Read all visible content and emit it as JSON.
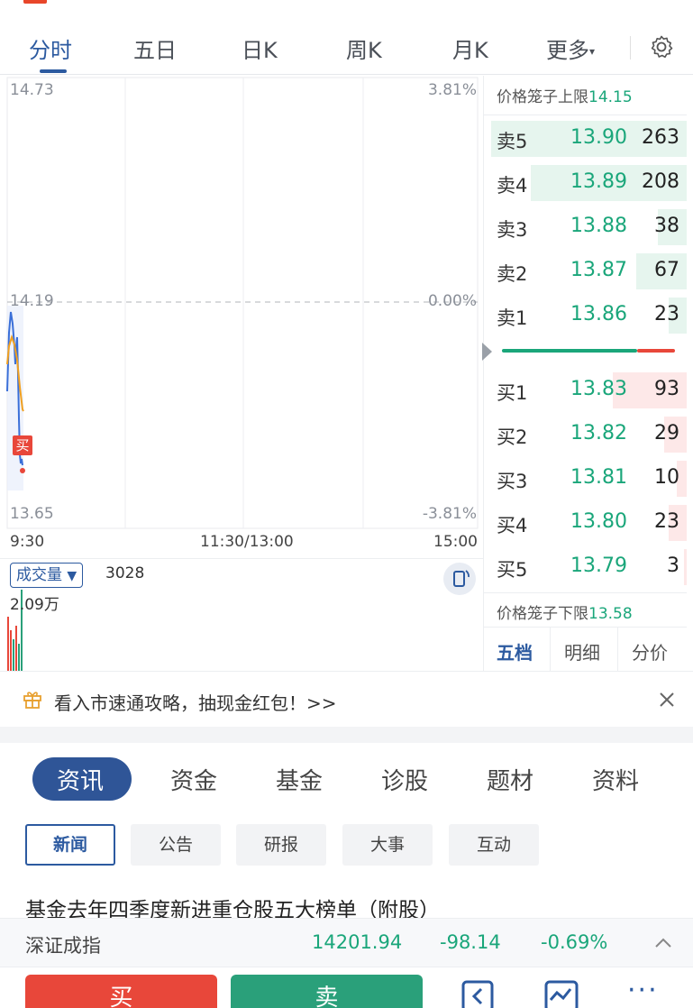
{
  "period_tabs": [
    {
      "label": "分时",
      "active": true
    },
    {
      "label": "五日"
    },
    {
      "label": "日K"
    },
    {
      "label": "周K"
    },
    {
      "label": "月K"
    },
    {
      "label": "更多"
    }
  ],
  "chart": {
    "y_top": "14.73",
    "y_mid": "14.19",
    "y_bottom": "13.65",
    "pct_top": "3.81%",
    "pct_mid": "0.00%",
    "pct_bottom": "-3.81%",
    "x_labels": [
      "9:30",
      "11:30/13:00",
      "15:00"
    ],
    "buy_marker": "买",
    "colors": {
      "price_line": "#3a6fd8",
      "avg_line": "#f0a020",
      "buy_marker": "#e8473a"
    }
  },
  "volume": {
    "selector_label": "成交量",
    "current": "3028",
    "max_label": "2.09万"
  },
  "order_book": {
    "upper_limit_label": "价格笼子上限",
    "upper_limit_value": "14.15",
    "lower_limit_label": "价格笼子下限",
    "lower_limit_value": "13.58",
    "asks": [
      {
        "label": "卖5",
        "price": "13.90",
        "volume": "263"
      },
      {
        "label": "卖4",
        "price": "13.89",
        "volume": "208"
      },
      {
        "label": "卖3",
        "price": "13.88",
        "volume": "38"
      },
      {
        "label": "卖2",
        "price": "13.87",
        "volume": "67"
      },
      {
        "label": "卖1",
        "price": "13.86",
        "volume": "23"
      }
    ],
    "bids": [
      {
        "label": "买1",
        "price": "13.83",
        "volume": "93"
      },
      {
        "label": "买2",
        "price": "13.82",
        "volume": "29"
      },
      {
        "label": "买3",
        "price": "13.81",
        "volume": "10"
      },
      {
        "label": "买4",
        "price": "13.80",
        "volume": "23"
      },
      {
        "label": "买5",
        "price": "13.79",
        "volume": "3"
      }
    ],
    "bottom_tabs": [
      "五档",
      "明细",
      "分价"
    ],
    "colors": {
      "price": "#1aa67a",
      "ask_bar": "#e6f5ee",
      "bid_bar": "#fde8e8"
    }
  },
  "promo": {
    "text": "看入市速通攻略，抽现金红包！>>"
  },
  "info_tabs": [
    "资讯",
    "资金",
    "基金",
    "诊股",
    "题材",
    "资料"
  ],
  "sub_tabs": [
    "新闻",
    "公告",
    "研报",
    "大事",
    "互动"
  ],
  "headline": "基金去年四季度新进重仓股五大榜单（附股）",
  "index_bar": {
    "name": "深证成指",
    "value": "14201.94",
    "change": "-98.14",
    "pct": "-0.69%"
  },
  "actions": {
    "buy": "买",
    "sell": "卖",
    "more": "···"
  }
}
